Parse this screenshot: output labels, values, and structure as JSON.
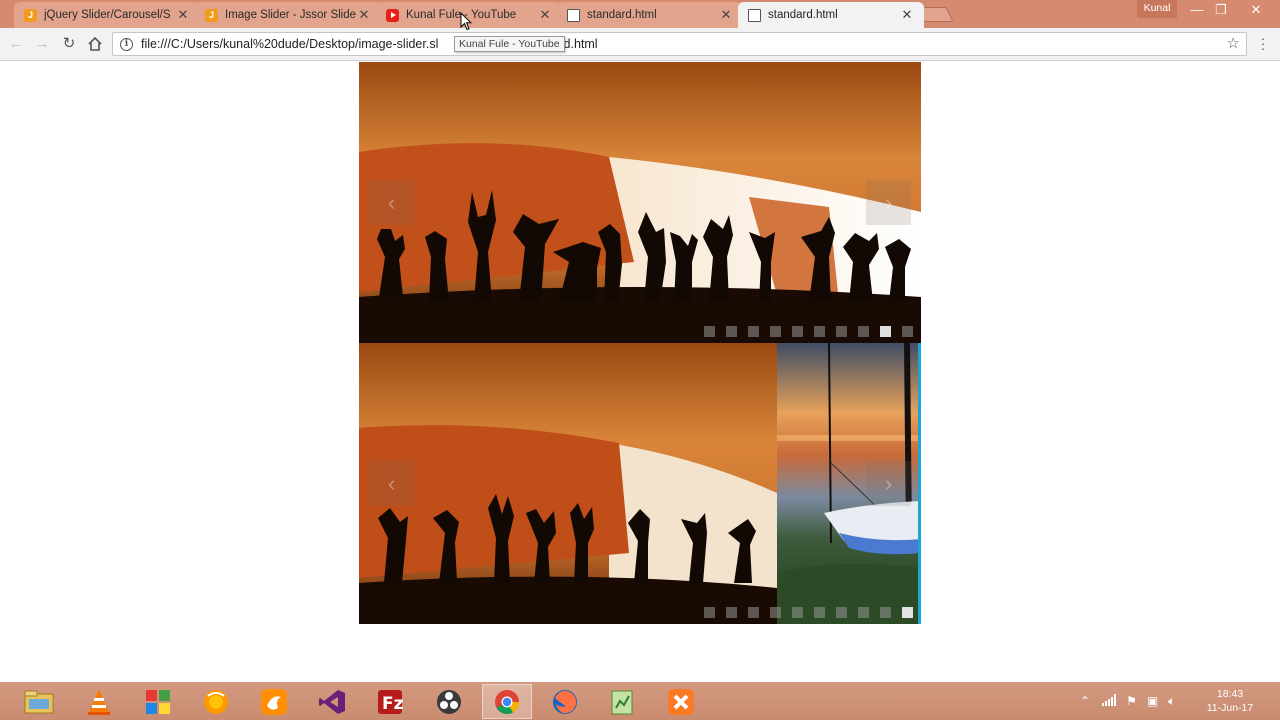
{
  "browser": {
    "tabs": [
      {
        "title": "jQuery Slider/Carousel/S",
        "favicon": "jssor-icon"
      },
      {
        "title": "Image Slider - Jssor Slide",
        "favicon": "jssor-icon"
      },
      {
        "title": "Kunal Fule - YouTube",
        "favicon": "youtube-icon"
      },
      {
        "title": "standard.html",
        "favicon": "file-icon"
      },
      {
        "title": "standard.html",
        "favicon": "file-icon",
        "active": true
      }
    ],
    "profile_name": "Kunal",
    "url": "file:///C:/Users/kunal%20dude/Desktop/image-slider.sl",
    "url_tail": "rd.html",
    "tooltip": "Kunal Fule - YouTube"
  },
  "sliders": [
    {
      "bullet_count": 10,
      "active_bullet": 8
    },
    {
      "bullet_count": 10,
      "active_bullet": 9
    }
  ],
  "taskbar": {
    "apps": [
      "file-explorer-icon",
      "vlc-icon",
      "windows-store-icon",
      "firefox-orange-icon",
      "uc-browser-icon",
      "visual-studio-icon",
      "filezilla-icon",
      "obs-icon",
      "chrome-icon",
      "firefox-icon",
      "notepad-plus-icon",
      "xampp-icon"
    ],
    "active_app": "chrome-icon",
    "time": "18:43",
    "date": "11-Jun-17"
  },
  "colors": {
    "tab_strip": "#d68a70",
    "taskbar": "#cb8e73"
  }
}
